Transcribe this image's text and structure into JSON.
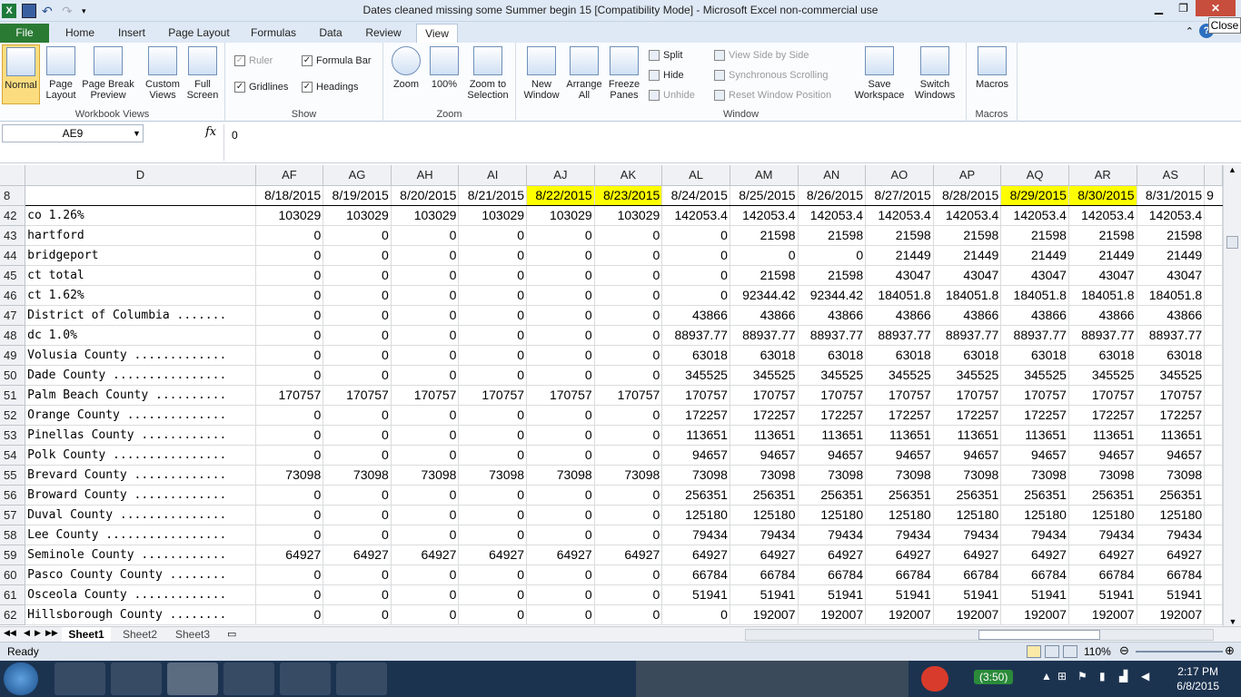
{
  "window": {
    "title": "Dates cleaned missing some Summer begin 15  [Compatibility Mode]  -  Microsoft Excel non-commercial use",
    "close_tooltip": "Close"
  },
  "tabs": [
    "File",
    "Home",
    "Insert",
    "Page Layout",
    "Formulas",
    "Data",
    "Review",
    "View"
  ],
  "ribbon": {
    "workbook_views": {
      "label": "Workbook Views",
      "buttons": [
        "Normal",
        "Page Layout",
        "Page Break Preview",
        "Custom Views",
        "Full Screen"
      ]
    },
    "show": {
      "label": "Show",
      "ruler": "Ruler",
      "formula_bar": "Formula Bar",
      "gridlines": "Gridlines",
      "headings": "Headings"
    },
    "zoom": {
      "label": "Zoom",
      "buttons": [
        "Zoom",
        "100%",
        "Zoom to Selection"
      ]
    },
    "window": {
      "label": "Window",
      "buttons": [
        "New Window",
        "Arrange All",
        "Freeze Panes"
      ],
      "split": "Split",
      "hide": "Hide",
      "unhide": "Unhide",
      "view_side": "View Side by Side",
      "sync_scroll": "Synchronous Scrolling",
      "reset_pos": "Reset Window Position",
      "save_ws": "Save Workspace",
      "switch": "Switch Windows"
    },
    "macros": {
      "label": "Macros",
      "button": "Macros"
    }
  },
  "formula_bar": {
    "name_box": "AE9",
    "fx": "fx",
    "value": "0"
  },
  "sheet": {
    "columns": [
      "D",
      "AF",
      "AG",
      "AH",
      "AI",
      "AJ",
      "AK",
      "AL",
      "AM",
      "AN",
      "AO",
      "AP",
      "AQ",
      "AR",
      "AS"
    ],
    "header_row": {
      "num": "8",
      "dates": [
        "8/18/2015",
        "8/19/2015",
        "8/20/2015",
        "8/21/2015",
        "8/22/2015",
        "8/23/2015",
        "8/24/2015",
        "8/25/2015",
        "8/26/2015",
        "8/27/2015",
        "8/28/2015",
        "8/29/2015",
        "8/30/2015",
        "8/31/2015"
      ],
      "highlight": [
        false,
        false,
        false,
        false,
        true,
        true,
        false,
        false,
        false,
        false,
        false,
        true,
        true,
        false
      ],
      "overflow": "9"
    },
    "rows": [
      {
        "n": "42",
        "label": "co 1.26%",
        "v": [
          "103029",
          "103029",
          "103029",
          "103029",
          "103029",
          "103029",
          "142053.4",
          "142053.4",
          "142053.4",
          "142053.4",
          "142053.4",
          "142053.4",
          "142053.4",
          "142053.4"
        ]
      },
      {
        "n": "43",
        "label": "hartford",
        "v": [
          "0",
          "0",
          "0",
          "0",
          "0",
          "0",
          "0",
          "21598",
          "21598",
          "21598",
          "21598",
          "21598",
          "21598",
          "21598"
        ]
      },
      {
        "n": "44",
        "label": "bridgeport",
        "v": [
          "0",
          "0",
          "0",
          "0",
          "0",
          "0",
          "0",
          "0",
          "0",
          "21449",
          "21449",
          "21449",
          "21449",
          "21449"
        ]
      },
      {
        "n": "45",
        "label": "ct total",
        "v": [
          "0",
          "0",
          "0",
          "0",
          "0",
          "0",
          "0",
          "21598",
          "21598",
          "43047",
          "43047",
          "43047",
          "43047",
          "43047"
        ]
      },
      {
        "n": "46",
        "label": "ct 1.62%",
        "v": [
          "0",
          "0",
          "0",
          "0",
          "0",
          "0",
          "0",
          "92344.42",
          "92344.42",
          "184051.8",
          "184051.8",
          "184051.8",
          "184051.8",
          "184051.8"
        ]
      },
      {
        "n": "47",
        "label": "District of Columbia .......",
        "v": [
          "0",
          "0",
          "0",
          "0",
          "0",
          "0",
          "43866",
          "43866",
          "43866",
          "43866",
          "43866",
          "43866",
          "43866",
          "43866"
        ]
      },
      {
        "n": "48",
        "label": "dc 1.0%",
        "v": [
          "0",
          "0",
          "0",
          "0",
          "0",
          "0",
          "88937.77",
          "88937.77",
          "88937.77",
          "88937.77",
          "88937.77",
          "88937.77",
          "88937.77",
          "88937.77"
        ]
      },
      {
        "n": "49",
        "label": "Volusia County .............",
        "v": [
          "0",
          "0",
          "0",
          "0",
          "0",
          "0",
          "63018",
          "63018",
          "63018",
          "63018",
          "63018",
          "63018",
          "63018",
          "63018"
        ]
      },
      {
        "n": "50",
        "label": "Dade County ................",
        "v": [
          "0",
          "0",
          "0",
          "0",
          "0",
          "0",
          "345525",
          "345525",
          "345525",
          "345525",
          "345525",
          "345525",
          "345525",
          "345525"
        ]
      },
      {
        "n": "51",
        "label": "Palm Beach County ..........",
        "v": [
          "170757",
          "170757",
          "170757",
          "170757",
          "170757",
          "170757",
          "170757",
          "170757",
          "170757",
          "170757",
          "170757",
          "170757",
          "170757",
          "170757"
        ]
      },
      {
        "n": "52",
        "label": "Orange County ..............",
        "v": [
          "0",
          "0",
          "0",
          "0",
          "0",
          "0",
          "172257",
          "172257",
          "172257",
          "172257",
          "172257",
          "172257",
          "172257",
          "172257"
        ]
      },
      {
        "n": "53",
        "label": "Pinellas County ............",
        "v": [
          "0",
          "0",
          "0",
          "0",
          "0",
          "0",
          "113651",
          "113651",
          "113651",
          "113651",
          "113651",
          "113651",
          "113651",
          "113651"
        ]
      },
      {
        "n": "54",
        "label": "Polk County ................",
        "v": [
          "0",
          "0",
          "0",
          "0",
          "0",
          "0",
          "94657",
          "94657",
          "94657",
          "94657",
          "94657",
          "94657",
          "94657",
          "94657"
        ]
      },
      {
        "n": "55",
        "label": "Brevard County .............",
        "v": [
          "73098",
          "73098",
          "73098",
          "73098",
          "73098",
          "73098",
          "73098",
          "73098",
          "73098",
          "73098",
          "73098",
          "73098",
          "73098",
          "73098"
        ]
      },
      {
        "n": "56",
        "label": "Broward County .............",
        "v": [
          "0",
          "0",
          "0",
          "0",
          "0",
          "0",
          "256351",
          "256351",
          "256351",
          "256351",
          "256351",
          "256351",
          "256351",
          "256351"
        ]
      },
      {
        "n": "57",
        "label": "Duval County ...............",
        "v": [
          "0",
          "0",
          "0",
          "0",
          "0",
          "0",
          "125180",
          "125180",
          "125180",
          "125180",
          "125180",
          "125180",
          "125180",
          "125180"
        ]
      },
      {
        "n": "58",
        "label": "Lee County .................",
        "v": [
          "0",
          "0",
          "0",
          "0",
          "0",
          "0",
          "79434",
          "79434",
          "79434",
          "79434",
          "79434",
          "79434",
          "79434",
          "79434"
        ]
      },
      {
        "n": "59",
        "label": "Seminole County ............",
        "v": [
          "64927",
          "64927",
          "64927",
          "64927",
          "64927",
          "64927",
          "64927",
          "64927",
          "64927",
          "64927",
          "64927",
          "64927",
          "64927",
          "64927"
        ]
      },
      {
        "n": "60",
        "label": "Pasco County County ........",
        "v": [
          "0",
          "0",
          "0",
          "0",
          "0",
          "0",
          "66784",
          "66784",
          "66784",
          "66784",
          "66784",
          "66784",
          "66784",
          "66784"
        ]
      },
      {
        "n": "61",
        "label": "Osceola County .............",
        "v": [
          "0",
          "0",
          "0",
          "0",
          "0",
          "0",
          "51941",
          "51941",
          "51941",
          "51941",
          "51941",
          "51941",
          "51941",
          "51941"
        ]
      },
      {
        "n": "62",
        "label": "Hillsborough County ........",
        "v": [
          "0",
          "0",
          "0",
          "0",
          "0",
          "0",
          "0",
          "192007",
          "192007",
          "192007",
          "192007",
          "192007",
          "192007",
          "192007"
        ]
      }
    ],
    "highlight_color": "#ffff00"
  },
  "sheet_tabs": [
    "Sheet1",
    "Sheet2",
    "Sheet3"
  ],
  "status": {
    "ready": "Ready",
    "zoom": "110%"
  },
  "taskbar": {
    "battery": "(3:50)",
    "time": "2:17 PM",
    "date": "6/8/2015"
  }
}
